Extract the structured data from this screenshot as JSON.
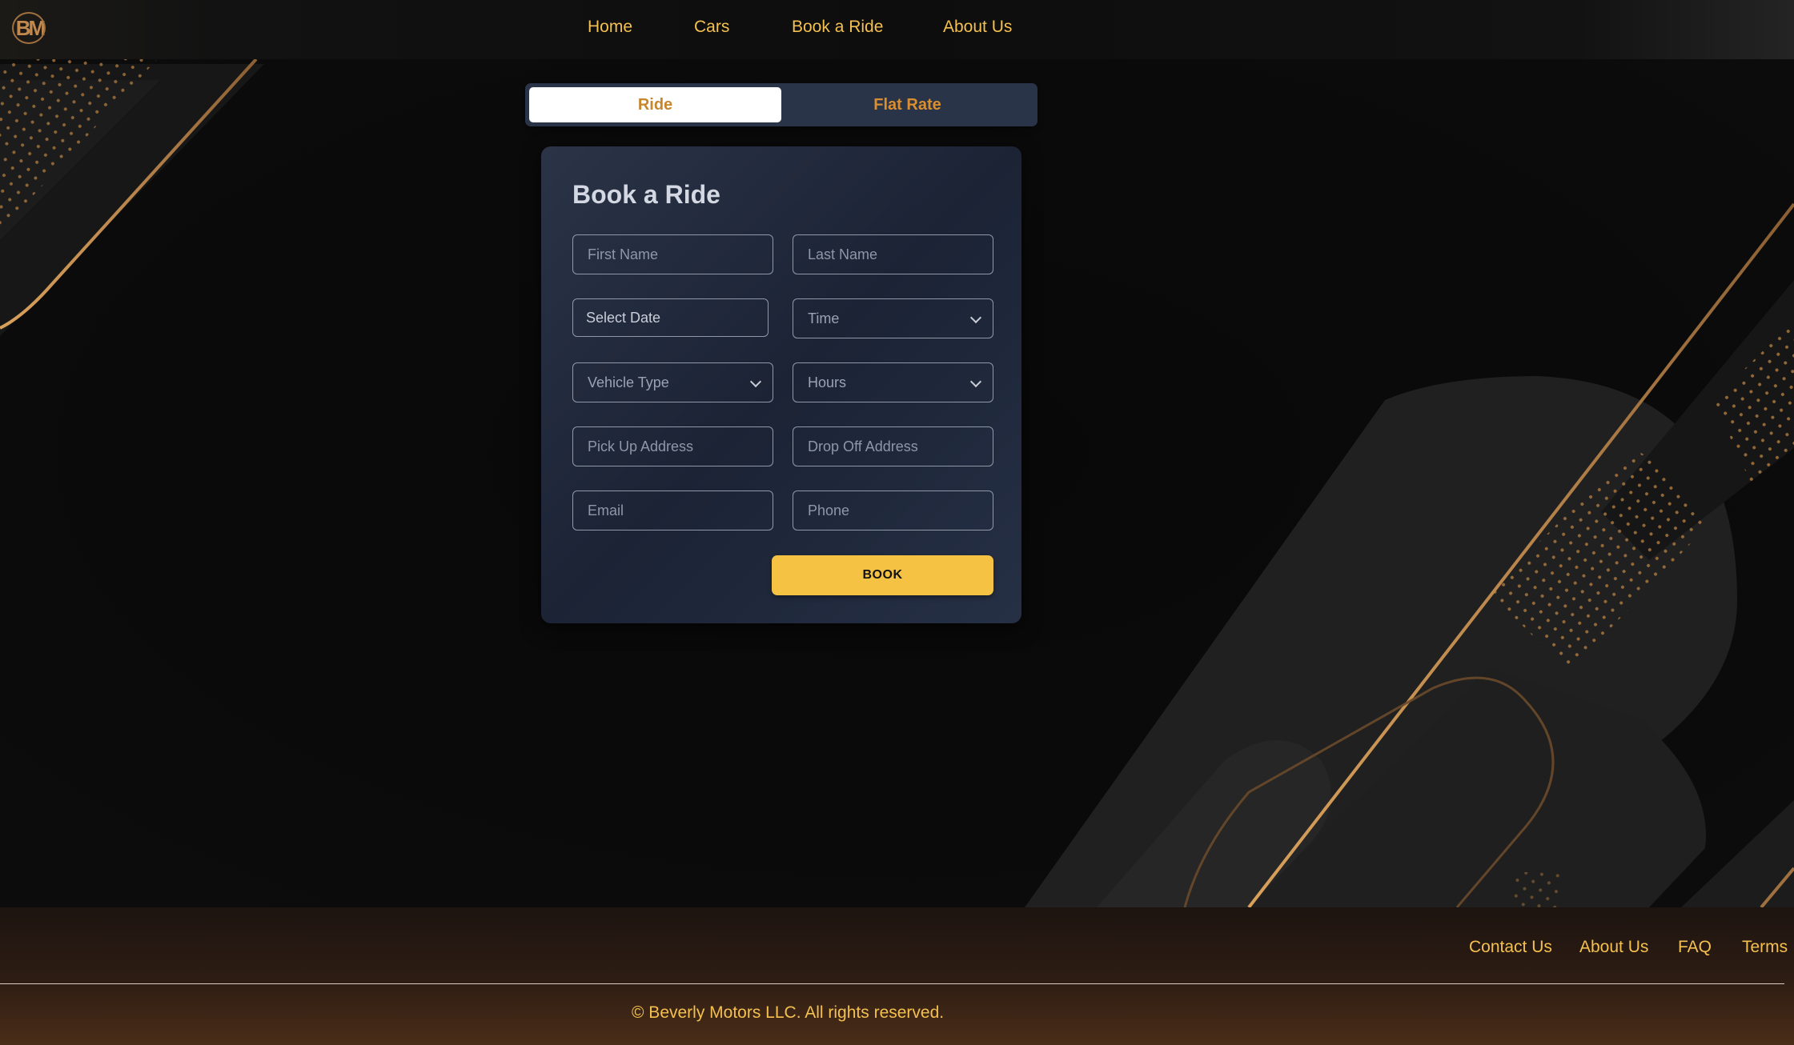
{
  "nav": {
    "logo": "BM",
    "links": [
      "Home",
      "Cars",
      "Book a Ride",
      "About Us"
    ]
  },
  "toggle": {
    "active": "Ride",
    "inactive": "Flat Rate"
  },
  "form": {
    "title": "Book a Ride",
    "first_name_placeholder": "First Name",
    "last_name_placeholder": "Last Name",
    "date_label": "Select Date",
    "time_label": "Time",
    "vehicle_type_label": "Vehicle Type",
    "hours_label": "Hours",
    "pickup_placeholder": "Pick Up Address",
    "dropoff_placeholder": "Drop Off Address",
    "email_placeholder": "Email",
    "phone_placeholder": "Phone",
    "submit_label": "BOOK"
  },
  "footer": {
    "links": [
      "Contact Us",
      "About Us",
      "FAQ",
      "Terms"
    ],
    "copyright": "© Beverly Motors LLC. All rights reserved."
  },
  "colors": {
    "accent_gold": "#f4c04f",
    "button_yellow": "#f5c244",
    "card_bg": "#1b2335",
    "tab_text": "#d98e2f"
  }
}
